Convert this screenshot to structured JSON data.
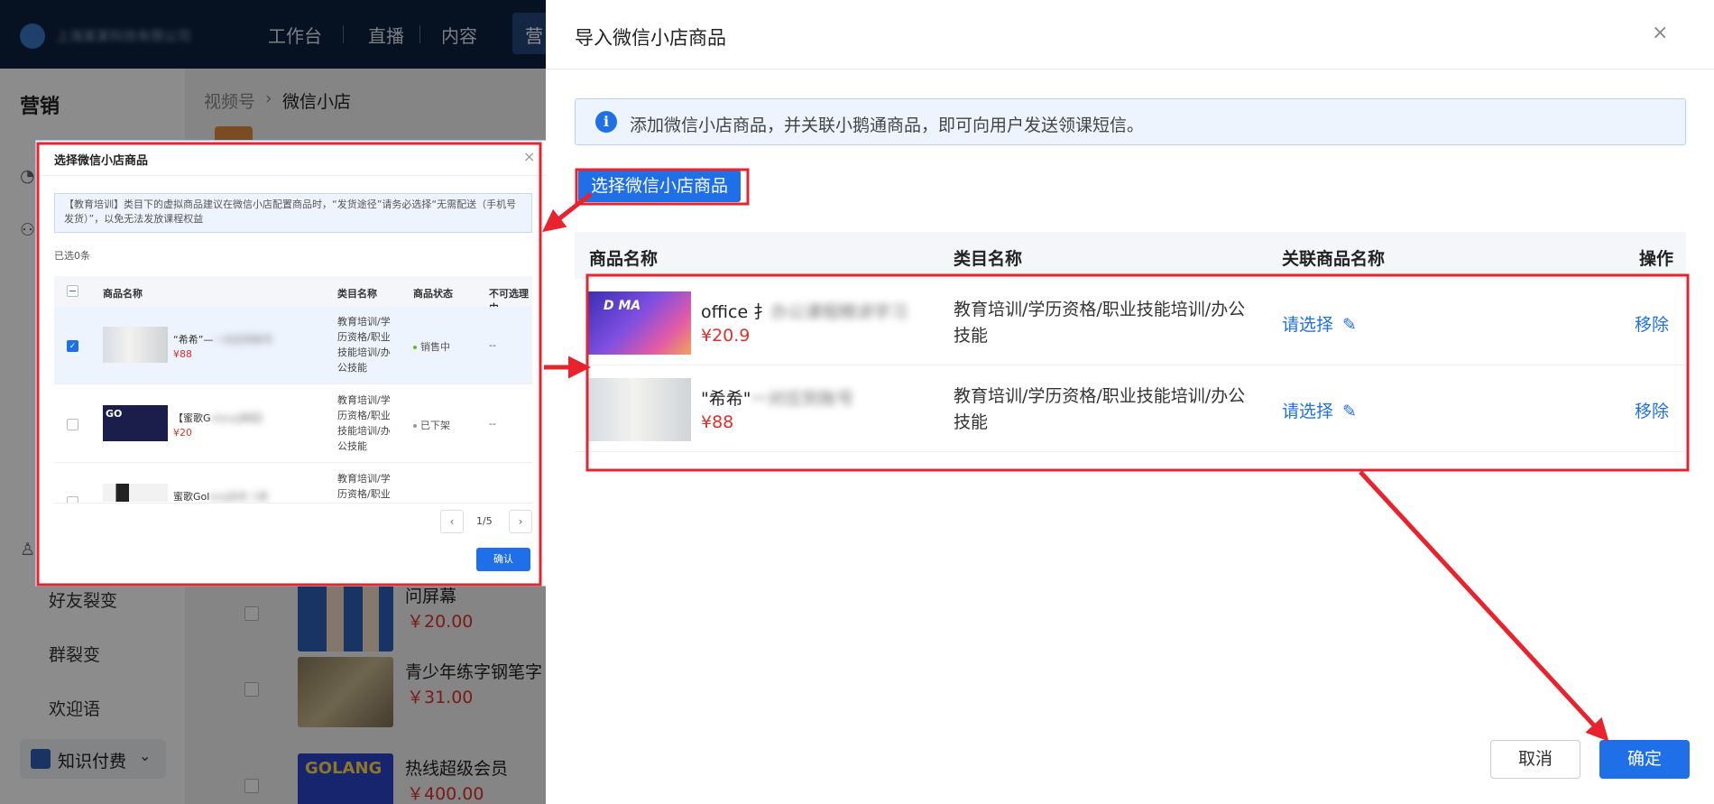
{
  "bg_app": {
    "org_name": "上海某某科技有限公司",
    "nav": [
      "工作台",
      "直播",
      "内容",
      "营"
    ],
    "sidebar": {
      "title": "营销",
      "items": [
        "好友裂变",
        "群裂变",
        "欢迎语"
      ],
      "bottom_label": "知识付费"
    },
    "breadcrumb": [
      "视频号",
      "微信小店"
    ],
    "products": [
      {
        "title": "问屏幕",
        "price": "￥20.00"
      },
      {
        "title": "青少年练字钢笔字",
        "price": "￥31.00"
      },
      {
        "title": "热线超级会员",
        "price": "￥400.00",
        "thumb_text": "GOLANG"
      }
    ]
  },
  "inset_dialog": {
    "title": "选择微信小店商品",
    "close": "×",
    "notice": "【教育培训】类目下的虚拟商品建议在微信小店配置商品时，“发货途径”请务必选择“无需配送（手机号发货）”，以免无法发放课程权益",
    "selected_count": "已选0条",
    "columns": [
      "商品名称",
      "类目名称",
      "商品状态",
      "不可选理由"
    ],
    "rows": [
      {
        "name": "“希希”—",
        "name_blur": "一对应到账号",
        "price": "¥88",
        "category": "教育培训/学历资格/职业技能培训/办公技能",
        "status": "销售中",
        "status_color": "#52c41a",
        "reason": "--",
        "checked": true
      },
      {
        "name": "【蜜歌G",
        "name_blur": "olang课程】",
        "price": "¥20",
        "category": "教育培训/学历资格/职业技能培训/办公技能",
        "status": "已下架",
        "status_color": "#999999",
        "reason": "--",
        "checked": false
      },
      {
        "name": "蜜歌Gol",
        "name_blur": "ang体系 1课",
        "price": "",
        "category": "教育培训/学历资格/职业技能培训/办公技能",
        "status": "",
        "status_color": "#999999",
        "reason": "",
        "checked": false
      }
    ],
    "pagination": {
      "prev": "‹",
      "page": "1/5",
      "next": "›"
    },
    "confirm": "确认"
  },
  "drawer": {
    "title": "导入微信小店商品",
    "close": "×",
    "notice_icon": "i",
    "notice": "添加微信小店商品，并关联小鹅通商品，即可向用户发送领课短信。",
    "select_button": "选择微信小店商品",
    "columns": [
      "商品名称",
      "类目名称",
      "关联商品名称",
      "操作"
    ],
    "rows": [
      {
        "name": "office 扌",
        "name_blur": "办公课程精讲学习",
        "price": "¥20.9",
        "category": "教育培训/学历资格/职业技能培训/办公技能",
        "link": "请选择",
        "action": "移除",
        "thumb_text": "D MA"
      },
      {
        "name": "\"希希\"",
        "name_blur": "一对应到账号",
        "price": "¥88",
        "category": "教育培训/学历资格/职业技能培训/办公技能",
        "link": "请选择",
        "action": "移除"
      }
    ],
    "cancel": "取消",
    "ok": "确定"
  },
  "colors": {
    "primary": "#1f6fe8",
    "price": "#e0302b",
    "annotation": "#e8232d",
    "topbar": "#0b1f3d"
  }
}
